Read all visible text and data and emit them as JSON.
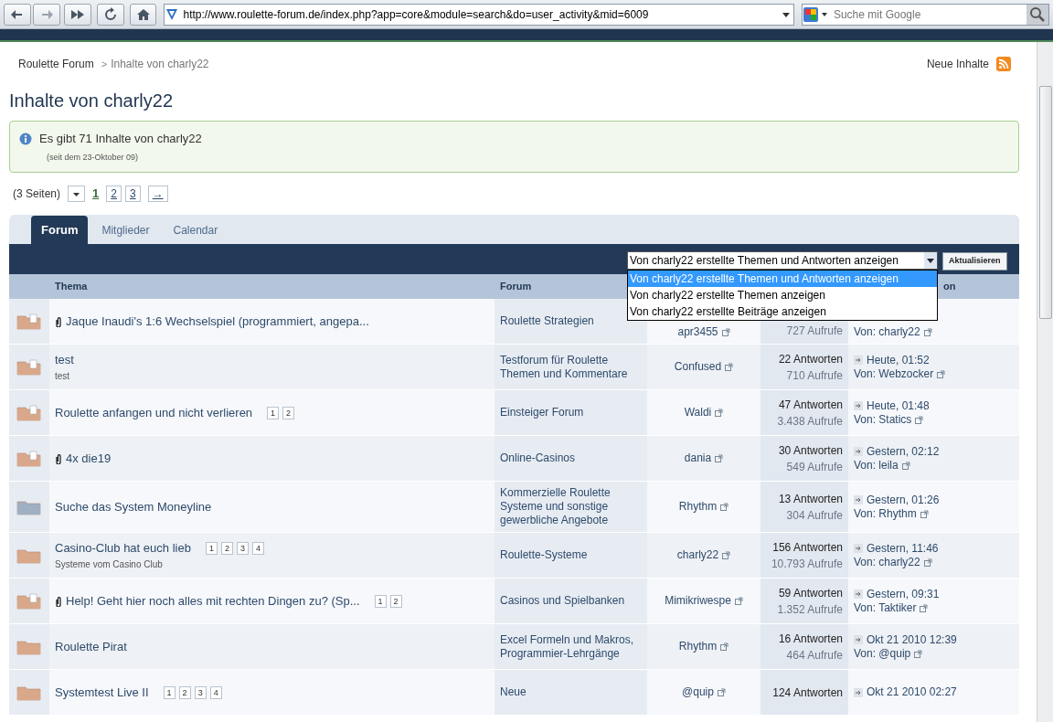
{
  "browser": {
    "url": "http://www.roulette-forum.de/index.php?app=core&module=search&do=user_activity&mid=6009",
    "search_placeholder": "Suche mit Google"
  },
  "breadcrumb": {
    "home": "Roulette Forum",
    "separator": ">",
    "current": "Inhalte von charly22"
  },
  "new_content": "Neue Inhalte",
  "heading": "Inhalte von charly22",
  "info": {
    "message": "Es gibt 71 Inhalte von charly22",
    "since": "(seit dem 23-Oktober 09)"
  },
  "pagination": {
    "count": "(3 Seiten)",
    "pages": [
      {
        "label": "1",
        "selected": true
      },
      {
        "label": "2",
        "selected": false
      },
      {
        "label": "3",
        "selected": false
      }
    ],
    "next": "→"
  },
  "tabs": [
    {
      "label": "Forum",
      "selected": true
    },
    {
      "label": "Mitglieder",
      "selected": false
    },
    {
      "label": "Calendar",
      "selected": false
    }
  ],
  "filter": {
    "value": "Von charly22 erstellte Themen und Antworten anzeigen",
    "expanded": true,
    "options": [
      {
        "label": "Von charly22 erstellte Themen und Antworten anzeigen",
        "selected": true
      },
      {
        "label": "Von charly22 erstellte Themen anzeigen",
        "selected": false
      },
      {
        "label": "Von charly22 erstellte Beiträge anzeigen",
        "selected": false
      }
    ],
    "button": "Aktualisieren"
  },
  "table": {
    "header": {
      "topic": "Thema",
      "forum": "Forum",
      "last_post": "on"
    },
    "rows": [
      {
        "kind": "posted",
        "attachment": true,
        "title": "Jaque Inaudi's 1:6 Wechselspiel (programmiert, angepa...",
        "forum": "Roulette Strategien",
        "author": "apr3455",
        "views": "727 Aufrufe",
        "last_by": "Von: charly22"
      },
      {
        "kind": "posted",
        "attachment": false,
        "title": "test",
        "description": "test",
        "forum": "Testforum für Roulette Themen und Kommentare",
        "author": "Confused",
        "replies": "22 Antworten",
        "views": "710 Aufrufe",
        "last_date": "Heute, 01:52",
        "last_by": "Von: Webzocker"
      },
      {
        "kind": "posted",
        "attachment": false,
        "title": "Roulette anfangen und nicht verlieren",
        "pages": [
          "1",
          "2"
        ],
        "forum": "Einsteiger Forum",
        "author": "Waldi",
        "replies": "47 Antworten",
        "views": "3.438 Aufrufe",
        "last_date": "Heute, 01:48",
        "last_by": "Von: Statics"
      },
      {
        "kind": "posted",
        "attachment": true,
        "title": "4x die19",
        "forum": "Online-Casinos",
        "author": "dania",
        "replies": "30 Antworten",
        "views": "549 Aufrufe",
        "last_date": "Gestern, 02:12",
        "last_by": "Von: leila"
      },
      {
        "kind": "read",
        "attachment": false,
        "title": "Suche das System Moneyline",
        "forum": "Kommerzielle Roulette Systeme und sonstige gewerbliche Angebote",
        "author": "Rhythm",
        "replies": "13 Antworten",
        "views": "304 Aufrufe",
        "last_date": "Gestern, 01:26",
        "last_by": "Von: Rhythm"
      },
      {
        "kind": "new",
        "attachment": false,
        "title": "Casino-Club hat euch lieb",
        "pages": [
          "1",
          "2",
          "3",
          "4"
        ],
        "description": "Systeme vom Casino Club",
        "forum": "Roulette-Systeme",
        "author": "charly22",
        "replies": "156 Antworten",
        "views": "10.793 Aufrufe",
        "last_date": "Gestern, 11:46",
        "last_by": "Von: charly22"
      },
      {
        "kind": "posted",
        "attachment": true,
        "title": "Help! Geht hier noch alles mit rechten Dingen zu? (Sp...",
        "pages": [
          "1",
          "2"
        ],
        "forum": "Casinos und Spielbanken",
        "author": "Mimikriwespe",
        "replies": "59 Antworten",
        "views": "1.352 Aufrufe",
        "last_date": "Gestern, 09:31",
        "last_by": "Von: Taktiker"
      },
      {
        "kind": "new",
        "attachment": false,
        "title": "Roulette Pirat",
        "forum": "Excel Formeln und Makros, Programmier-Lehrgänge",
        "author": "Rhythm",
        "replies": "16 Antworten",
        "views": "464 Aufrufe",
        "last_date": "Okt 21 2010 12:39",
        "last_by": "Von: @quip"
      },
      {
        "kind": "new",
        "attachment": false,
        "title": "Systemtest Live II",
        "pages": [
          "1",
          "2",
          "3",
          "4"
        ],
        "forum": "Neue",
        "author": "@quip",
        "replies": "124 Antworten",
        "last_date": "Okt 21 2010 02:27"
      }
    ]
  }
}
